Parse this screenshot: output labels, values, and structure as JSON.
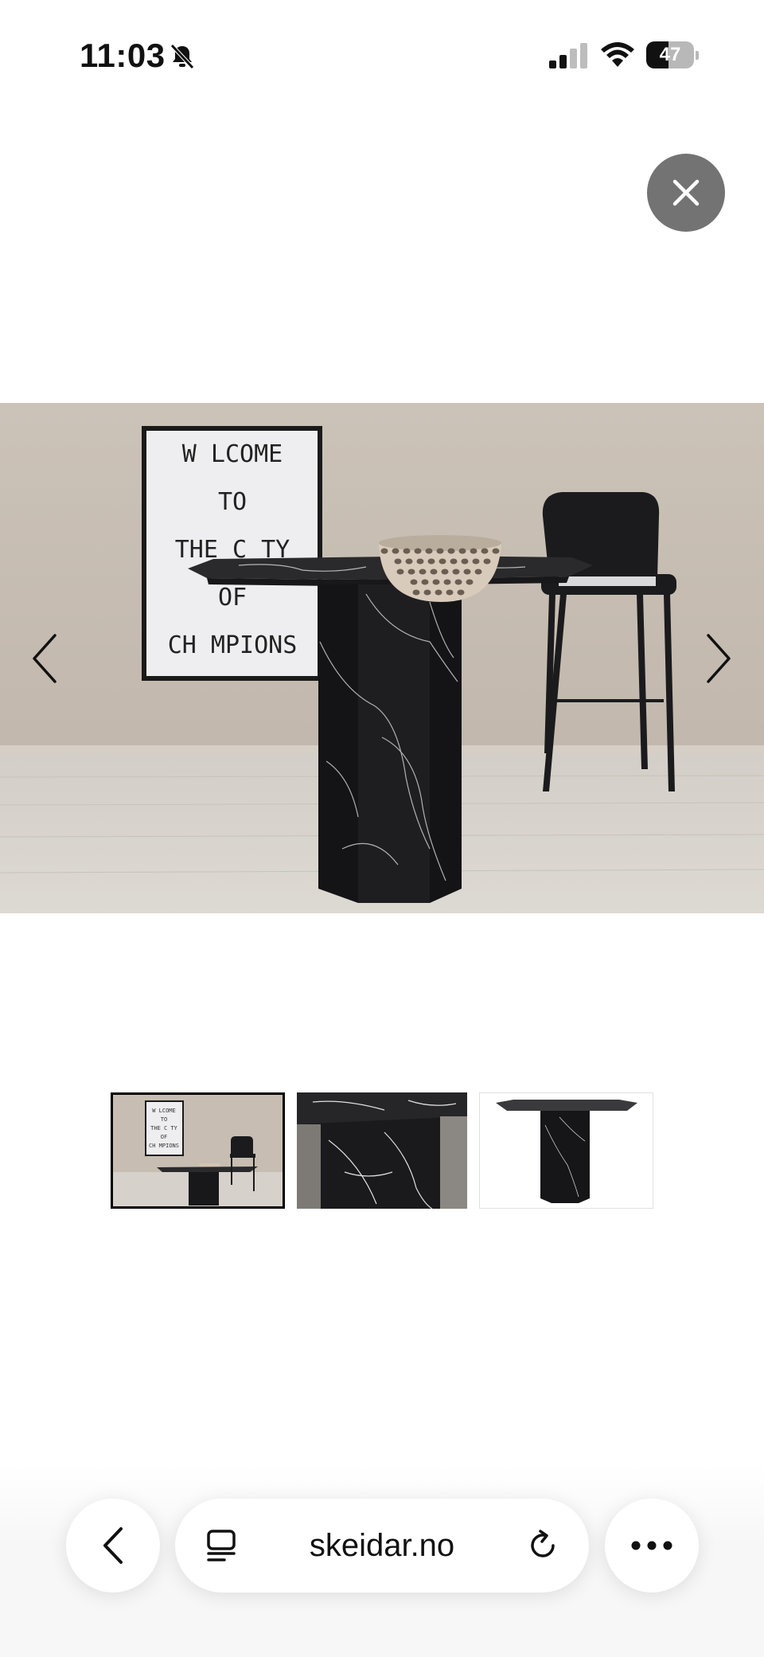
{
  "status_bar": {
    "time": "11:03",
    "battery_percent": "47",
    "battery_level": 0.47,
    "icons": [
      "bell-slash-icon",
      "signal-icon",
      "wifi-icon",
      "battery-icon"
    ]
  },
  "viewer": {
    "close_icon": "close-icon",
    "prev_icon": "chevron-left-icon",
    "next_icon": "chevron-right-icon",
    "poster_lines": [
      "W LCOME",
      "TO",
      "THE C TY",
      "OF",
      "CH MPIONS"
    ],
    "thumbnails": [
      {
        "label": "room-scene",
        "selected": true
      },
      {
        "label": "marble-closeup",
        "selected": false
      },
      {
        "label": "product-white",
        "selected": false
      }
    ]
  },
  "browser_bar": {
    "url": "skeidar.no",
    "back_icon": "chevron-left-icon",
    "reader_icon": "reader-icon",
    "reload_icon": "reload-icon",
    "more_icon": "more-icon"
  },
  "colors": {
    "wall": "#c9c0b6",
    "floor": "#d8d3cc",
    "marble": "#1c1c1e",
    "close_bg": "#737373"
  }
}
